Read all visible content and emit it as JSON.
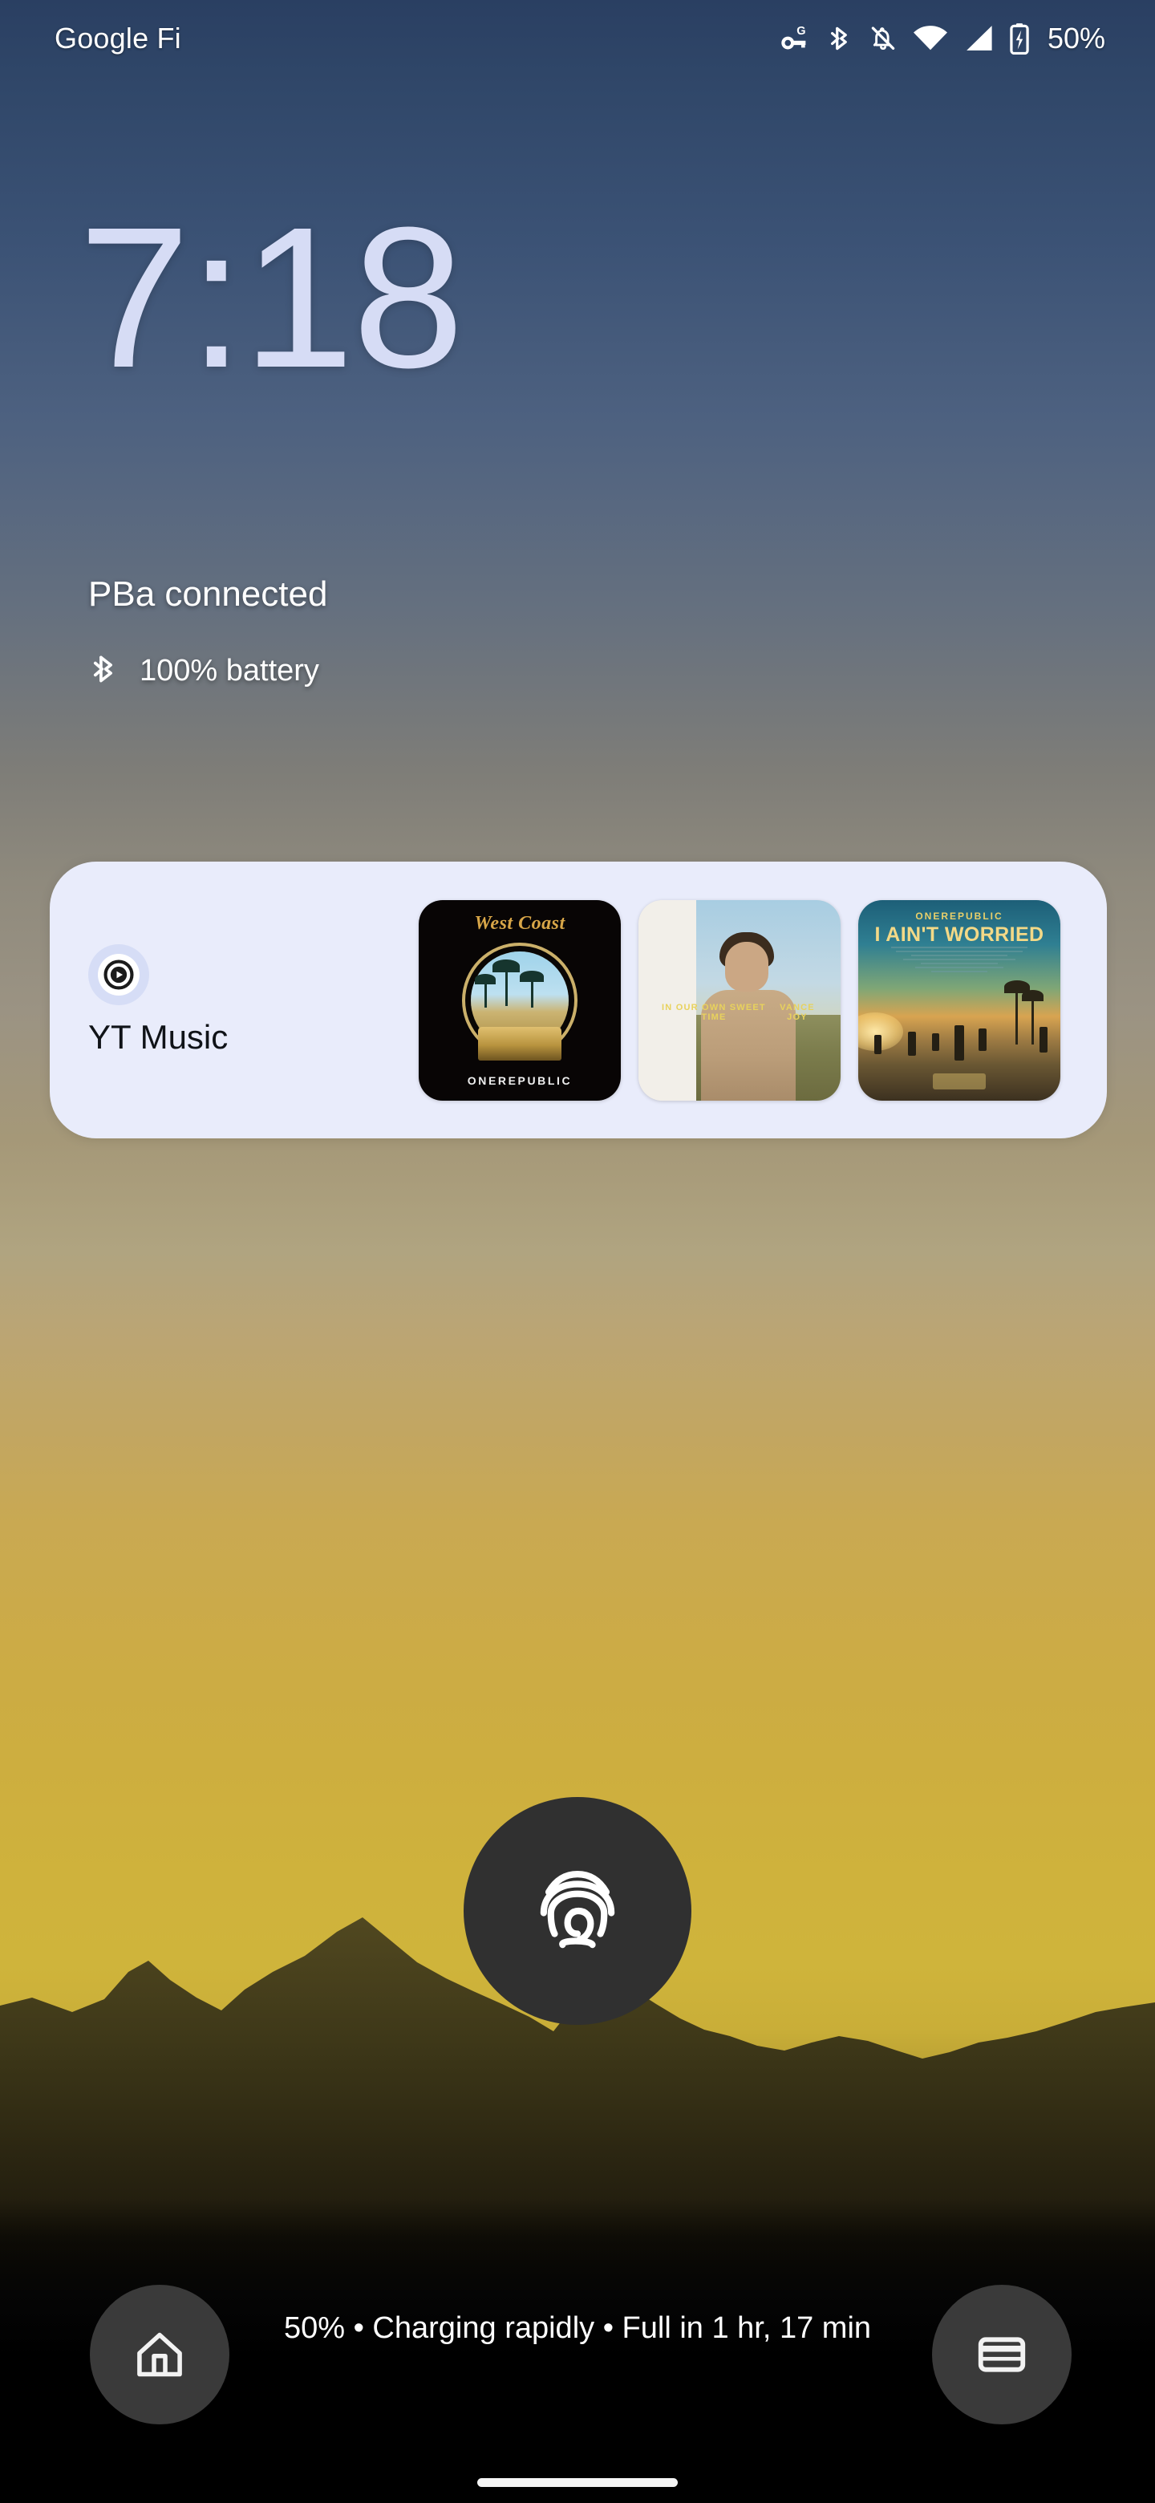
{
  "status_bar": {
    "carrier": "Google Fi",
    "battery_percent": "50%",
    "icons": [
      {
        "name": "vpn-key-icon",
        "label": "VPN key G"
      },
      {
        "name": "bluetooth-icon",
        "label": "Bluetooth"
      },
      {
        "name": "notifications-off-icon",
        "label": "Notifications silenced"
      },
      {
        "name": "wifi-icon",
        "label": "Wi-Fi full signal"
      },
      {
        "name": "cellular-signal-icon",
        "label": "Mobile signal"
      },
      {
        "name": "battery-charging-icon",
        "label": "Battery charging"
      }
    ]
  },
  "clock": {
    "time": "7:18",
    "color": "#d6dcf5"
  },
  "notification": {
    "title": "PBa connected",
    "battery_line": "100% battery",
    "icon": "bluetooth-icon"
  },
  "widget": {
    "app_name": "YT Music",
    "app_icon": "youtube-music-icon",
    "card_color": "#e9ecfb",
    "albums": [
      {
        "name": "album-art-west-coast",
        "title": "West Coast",
        "artist": "ONEREPUBLIC"
      },
      {
        "name": "album-art-in-our-own-sweet-time",
        "title": "IN OUR OWN SWEET TIME",
        "artist": "VANCE JOY"
      },
      {
        "name": "album-art-i-aint-worried",
        "title": "I AIN'T WORRIED",
        "artist": "ONEREPUBLIC"
      }
    ]
  },
  "unlock": {
    "fingerprint_icon": "fingerprint-icon",
    "circle_color": "#303030"
  },
  "bottom_bar": {
    "left_shortcut": {
      "icon": "home-icon",
      "label": "Home controls"
    },
    "right_shortcut": {
      "icon": "wallet-card-icon",
      "label": "Wallet"
    },
    "charging_status": "50% • Charging rapidly • Full in 1 hr, 17 min"
  },
  "navigation": {
    "home_indicator": "home-indicator-bar"
  }
}
